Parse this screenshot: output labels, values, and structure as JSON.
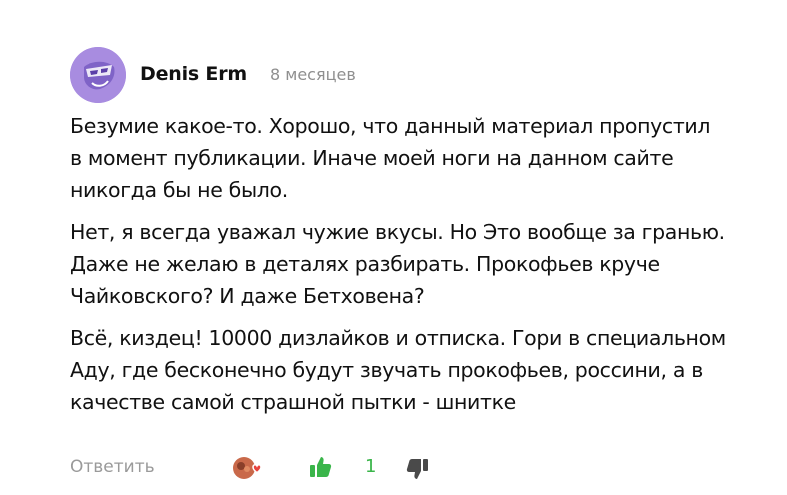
{
  "comment": {
    "author": "Denis Erm",
    "time": "8 месяцев",
    "paragraphs": [
      "Безумие какое-то. Хорошо, что данный материал пропустил\nв момент публикации. Иначе моей ноги на данном сайте\nникогда бы не было.",
      "Нет, я всегда уважал чужие вкусы. Но Это вообще за гранью.\nДаже не желаю в деталях разбирать. Прокофьев круче\nЧайковского? И даже Бетховена?",
      "Всё, киздец! 10000 дизлайков и отписка. Гори в специальном\nАду, где бесконечно будут звучать прокофьев, россини, а в\nкачестве самой страшной пытки - шнитке"
    ]
  },
  "footer": {
    "reply_label": "Ответить",
    "like_count": "1"
  },
  "colors": {
    "avatar_bg": "#a88ce0",
    "like_green": "#3ab54a",
    "muted": "#9a9a9a"
  },
  "icons": {
    "avatar": "mask-avatar",
    "reactions": "reactions-icon",
    "like": "thumbs-up-icon",
    "dislike": "thumbs-down-icon"
  }
}
